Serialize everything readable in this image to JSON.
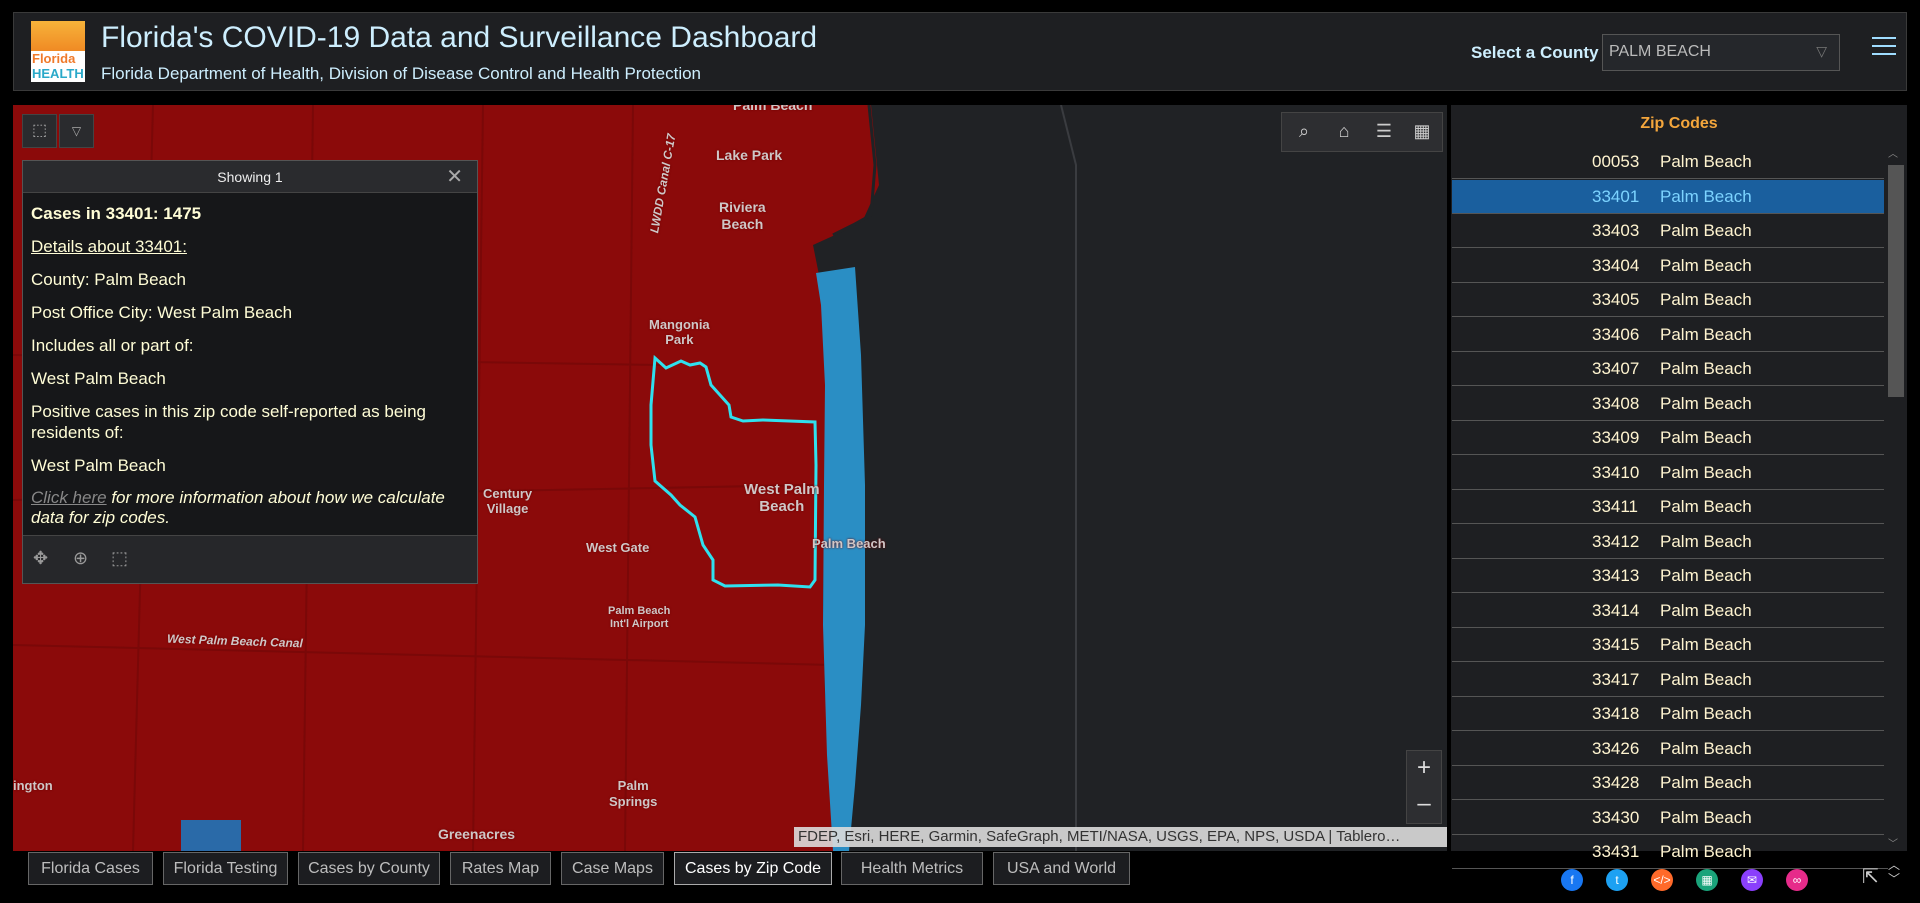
{
  "header": {
    "logo_line1": "Florida",
    "logo_line2": "HEALTH",
    "title": "Florida's COVID-19 Data and Surveillance Dashboard",
    "subtitle": "Florida Department of Health, Division of Disease Control and Health Protection",
    "county_label": "Select a County",
    "county_value": "PALM BEACH"
  },
  "map": {
    "labels": {
      "palm_beach_top": "Palm Beach",
      "lake_park": "Lake Park",
      "riviera": "Riviera\nBeach",
      "canal_c17": "LWDD Canal C-17",
      "mangonia": "Mangonia\nPark",
      "century_village": "Century\nVillage",
      "west_palm_beach": "West Palm\nBeach",
      "palm_beach": "Palm Beach",
      "west_gate": "West Gate",
      "airport": "Palm Beach\nInt'l Airport",
      "wpb_canal": "West Palm Beach Canal",
      "ington": "ington",
      "palm_springs": "Palm\nSprings",
      "greenacres": "Greenacres"
    },
    "attribution": "FDEP, Esri, HERE, Garmin, SafeGraph, METI/NASA, USGS, EPA, NPS, USDA | Tablero…",
    "zoom_in": "+",
    "zoom_out": "–"
  },
  "popup": {
    "header": "Showing 1",
    "cases_line": "Cases in 33401: 1475",
    "details_link": "Details about 33401:",
    "county": "County: Palm Beach",
    "post_office": "Post Office City: West Palm Beach",
    "includes_label": "Includes all or part of:",
    "includes_value": "West Palm Beach",
    "residents_label": "Positive cases in this zip code self-reported as being residents of:",
    "residents_value": "West Palm Beach",
    "click_here": "Click here",
    "more_info": " for more information about how we calculate data for zip codes."
  },
  "zip_panel": {
    "title": "Zip Codes",
    "rows": [
      {
        "zip": "00053",
        "name": "Palm Beach"
      },
      {
        "zip": "33401",
        "name": "Palm Beach",
        "selected": true
      },
      {
        "zip": "33403",
        "name": "Palm Beach"
      },
      {
        "zip": "33404",
        "name": "Palm Beach"
      },
      {
        "zip": "33405",
        "name": "Palm Beach"
      },
      {
        "zip": "33406",
        "name": "Palm Beach"
      },
      {
        "zip": "33407",
        "name": "Palm Beach"
      },
      {
        "zip": "33408",
        "name": "Palm Beach"
      },
      {
        "zip": "33409",
        "name": "Palm Beach"
      },
      {
        "zip": "33410",
        "name": "Palm Beach"
      },
      {
        "zip": "33411",
        "name": "Palm Beach"
      },
      {
        "zip": "33412",
        "name": "Palm Beach"
      },
      {
        "zip": "33413",
        "name": "Palm Beach"
      },
      {
        "zip": "33414",
        "name": "Palm Beach"
      },
      {
        "zip": "33415",
        "name": "Palm Beach"
      },
      {
        "zip": "33417",
        "name": "Palm Beach"
      },
      {
        "zip": "33418",
        "name": "Palm Beach"
      },
      {
        "zip": "33426",
        "name": "Palm Beach"
      },
      {
        "zip": "33428",
        "name": "Palm Beach"
      },
      {
        "zip": "33430",
        "name": "Palm Beach"
      },
      {
        "zip": "33431",
        "name": "Palm Beach"
      }
    ]
  },
  "tabs": [
    {
      "label": "Florida Cases"
    },
    {
      "label": "Florida Testing"
    },
    {
      "label": "Cases by County"
    },
    {
      "label": "Rates Map"
    },
    {
      "label": "Case Maps"
    },
    {
      "label": "Cases by Zip Code",
      "active": true
    },
    {
      "label": "Health Metrics"
    },
    {
      "label": "USA and World"
    }
  ],
  "social": [
    {
      "name": "facebook-icon",
      "glyph": "f",
      "color": "#1877f2"
    },
    {
      "name": "twitter-icon",
      "glyph": "t",
      "color": "#1da1f2"
    },
    {
      "name": "embed-icon",
      "glyph": "</>",
      "color": "#ff6a2a"
    },
    {
      "name": "classroom-icon",
      "glyph": "▦",
      "color": "#1aa37a"
    },
    {
      "name": "email-icon",
      "glyph": "✉",
      "color": "#8a3ffc"
    },
    {
      "name": "link-icon",
      "glyph": "∞",
      "color": "#e62b8a"
    }
  ],
  "colors": {
    "zip_fill": "#8b0a0a",
    "coast_blue": "#2a8ec4",
    "highlight_outline": "#2fe0ee",
    "accent_orange": "#f4a63c",
    "selected_row": "#1a5f9e"
  }
}
